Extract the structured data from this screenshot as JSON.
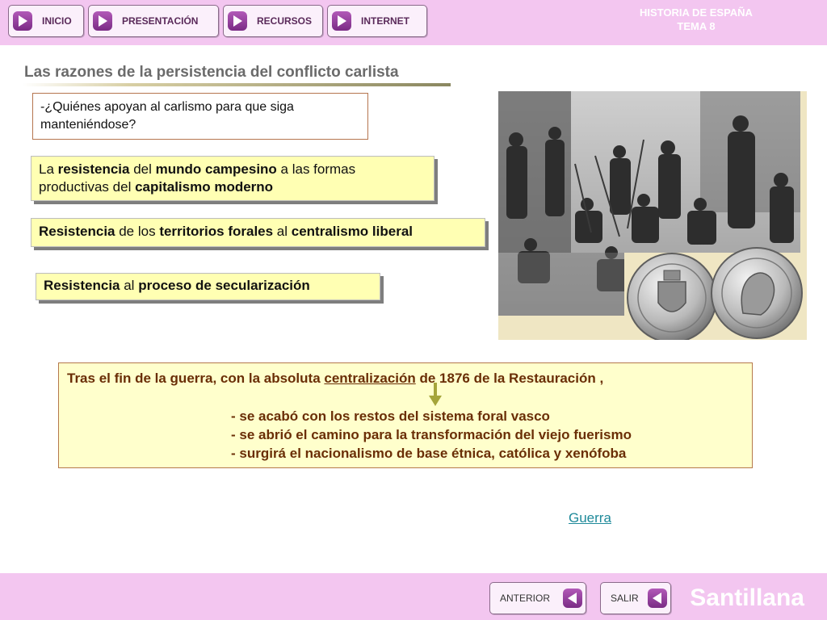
{
  "nav": {
    "buttons": [
      {
        "label": "INICIO"
      },
      {
        "label": "PRESENTACIÓN"
      },
      {
        "label": "RECURSOS"
      },
      {
        "label": "INTERNET"
      }
    ],
    "course_title": "HISTORIA DE ESPAÑA",
    "course_unit": "TEMA 8"
  },
  "slide": {
    "title": "Las razones de la persistencia del conflicto carlista",
    "question": "-¿Quiénes apoyan al carlismo para que siga manteniéndose?",
    "box1": {
      "t1": "La ",
      "b1": "resistencia",
      "t2": " del ",
      "b2": "mundo campesino",
      "t3": " a las formas productivas del ",
      "b3": "capitalismo moderno"
    },
    "box2": {
      "b1": "Resistencia",
      "t1": " de los ",
      "b2": "territorios forales",
      "t2": " al ",
      "b3": "centralismo liberal"
    },
    "box3": {
      "b1": "Resistencia",
      "t1": " al ",
      "b2": "proceso de secularización"
    },
    "summary": {
      "intro_a": "Tras el fin de la guerra, con la absoluta ",
      "intro_u": "centralización",
      "intro_b": " de 1876 de la Restauración ,",
      "items": [
        "- se acabó con los restos del sistema foral vasco",
        "- se abrió el camino para la transformación del viejo fuerismo",
        "- surgirá el nacionalismo de base étnica, católica y xenófoba"
      ]
    },
    "link": "Guerra"
  },
  "footer": {
    "prev_label": "ANTERIOR",
    "exit_label": "SALIR",
    "brand": "Santillana"
  },
  "colors": {
    "bar": "#f3c6f0",
    "button_icon": "#8e3b96",
    "callout_bg": "#ffffb3",
    "summary_text": "#6a2e06",
    "link": "#1f8a9a"
  },
  "icons": {
    "nav_button": "play-right-icon",
    "footer_button": "play-left-icon",
    "annotation": "down-arrow-icon"
  }
}
